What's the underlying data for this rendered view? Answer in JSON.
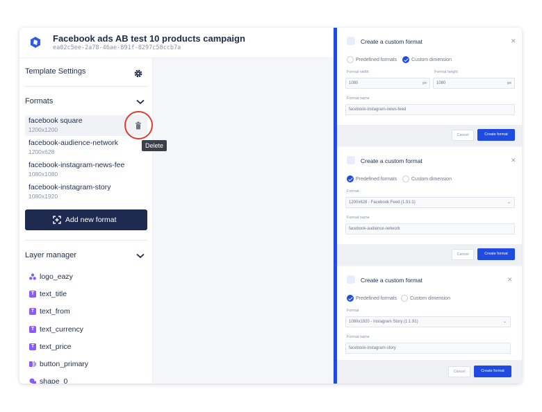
{
  "header": {
    "title": "Facebook ads AB test 10 products campaign",
    "subtitle": "ea02c5ee-2a78-46ae-891f-8297c58ccb7a"
  },
  "sidebar": {
    "template_settings_label": "Template Settings",
    "formats_label": "Formats",
    "formats": [
      {
        "name": "facebook square",
        "size": "1200x1200",
        "selected": true
      },
      {
        "name": "facebook-audience-network",
        "size": "1200x628"
      },
      {
        "name": "facebook-instagram-news-fee",
        "size": "1080x1080"
      },
      {
        "name": "facebook-instagram-story",
        "size": "1080x1920"
      }
    ],
    "delete_tooltip": "Delete",
    "add_format_label": "Add new format",
    "layer_manager_label": "Layer manager",
    "layers": [
      {
        "name": "logo_eazy",
        "icon": "group-icon"
      },
      {
        "name": "text_title",
        "icon": "text-icon"
      },
      {
        "name": "text_from",
        "icon": "text-icon"
      },
      {
        "name": "text_currency",
        "icon": "text-icon"
      },
      {
        "name": "text_price",
        "icon": "text-icon"
      },
      {
        "name": "button_primary",
        "icon": "button-icon"
      },
      {
        "name": "shape_0",
        "icon": "shape-icon"
      }
    ]
  },
  "panels": [
    {
      "title": "Create a custom format",
      "mode_predefined": "Predefined formats",
      "mode_custom": "Custom dimension",
      "selected_mode": "custom",
      "width_label": "Format width",
      "width_value": "1080",
      "height_label": "Format height",
      "height_value": "1080",
      "unit": "px",
      "name_label": "Format name",
      "name_value": "facebook-instagram-news-feed",
      "cancel": "Cancel",
      "create": "Create format"
    },
    {
      "title": "Create a custom format",
      "mode_predefined": "Predefined formats",
      "mode_custom": "Custom dimension",
      "selected_mode": "predefined",
      "format_label": "Format",
      "format_value": "1200x628 - Facebook Feed (1.91:1)",
      "name_label": "Format name",
      "name_value": "facebook-audience-network",
      "cancel": "Cancel",
      "create": "Create format"
    },
    {
      "title": "Create a custom format",
      "mode_predefined": "Predefined formats",
      "mode_custom": "Custom dimension",
      "selected_mode": "predefined",
      "format_label": "Format",
      "format_value": "1080x1920 - Instagram Story (1:1.91)",
      "name_label": "Format name",
      "name_value": "facebook-instagram-story",
      "cancel": "Cancel",
      "create": "Create format"
    }
  ],
  "colors": {
    "accent": "#1f4be0",
    "dark_button": "#1e2a4f",
    "highlight_ring": "#e03c2c",
    "layer_icon": "#8a5cf5"
  }
}
